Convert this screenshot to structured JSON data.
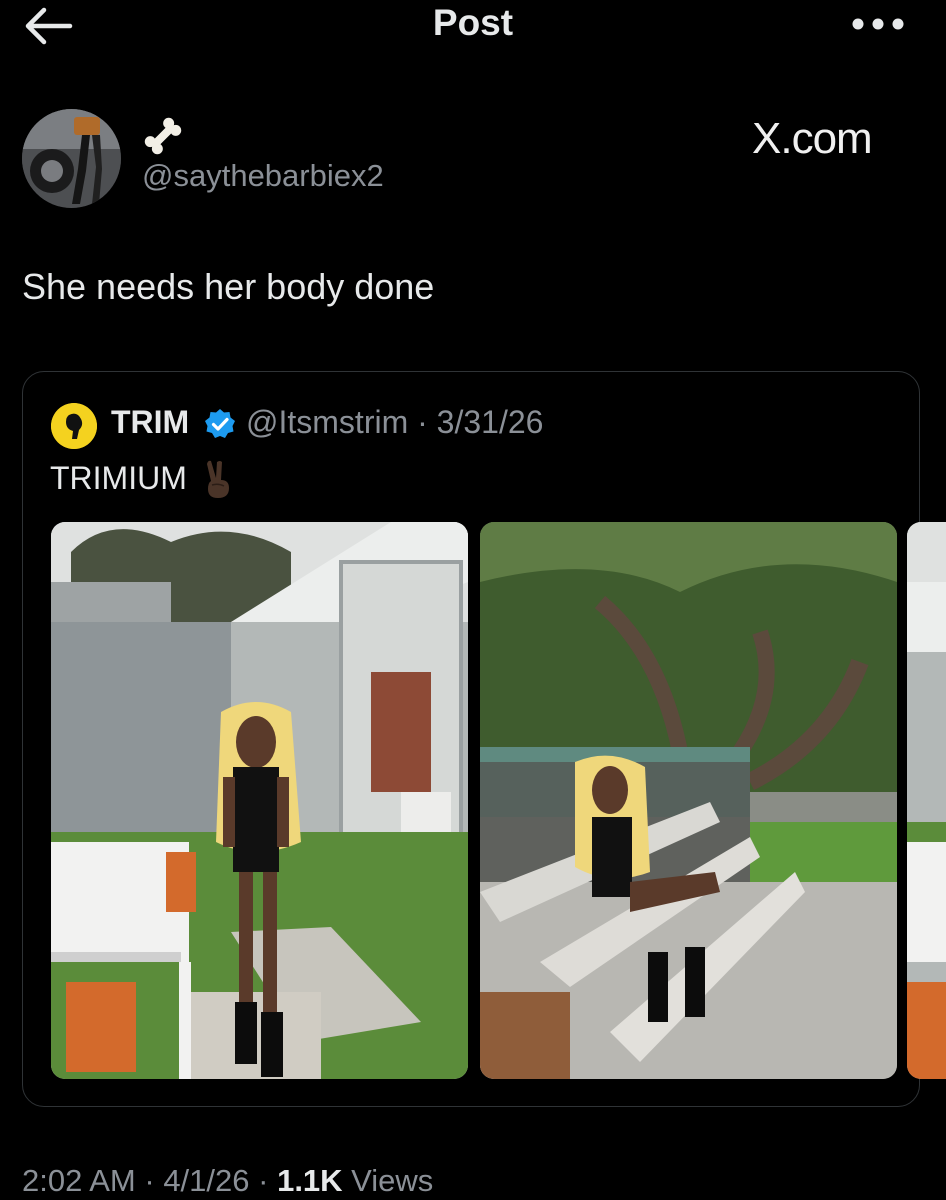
{
  "header": {
    "title": "Post",
    "back_icon": "arrow-left-icon",
    "more_icon": "more-horizontal-icon"
  },
  "author": {
    "display_name_icon": "bone-emoji",
    "handle": "@saythebarbiex2"
  },
  "watermark": "X.com",
  "post": {
    "text": "She needs her body done"
  },
  "quoted": {
    "name": "TRIM",
    "verified": true,
    "verified_color": "#1d9bf0",
    "handle_date": "@Itsmstrim · 3/31/26",
    "text": "TRIMIUM",
    "emoji": "victory-hand-emoji",
    "photos": [
      {
        "icon": "photo-house-glass-wall"
      },
      {
        "icon": "photo-garden-bench-tree"
      },
      {
        "icon": "photo-partial"
      }
    ]
  },
  "meta": {
    "time": "2:02 AM",
    "sep1": " · ",
    "date": "4/1/26",
    "sep2": " · ",
    "views_count": "1.1K",
    "views_label": " Views"
  },
  "colors": {
    "background": "#000000",
    "text": "#e7e9ea",
    "secondary": "#8b9097",
    "border": "#2f3336",
    "avatar_yellow": "#f4d21f"
  }
}
